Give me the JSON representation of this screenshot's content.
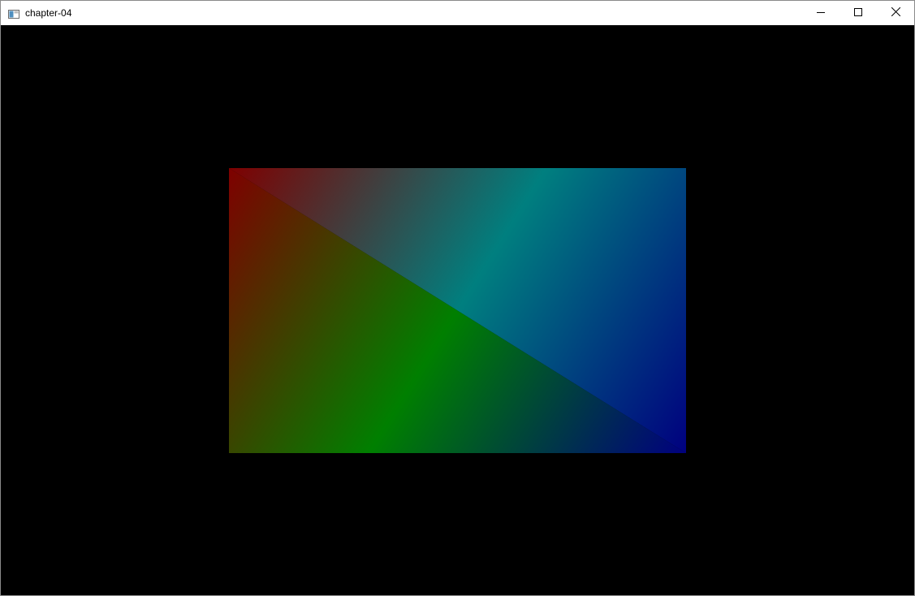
{
  "window": {
    "title": "chapter-04"
  },
  "titlebar": {
    "icons": {
      "app": "app-window-icon",
      "minimize": "minimize-icon",
      "maximize": "maximize-icon",
      "close": "close-icon"
    }
  },
  "canvas": {
    "background": "#000000",
    "quad": {
      "corner_colors": {
        "top_left": "#7f0000",
        "top_right": "#007f7f",
        "bottom_left": "#007f00",
        "bottom_right": "#00007f"
      }
    }
  }
}
